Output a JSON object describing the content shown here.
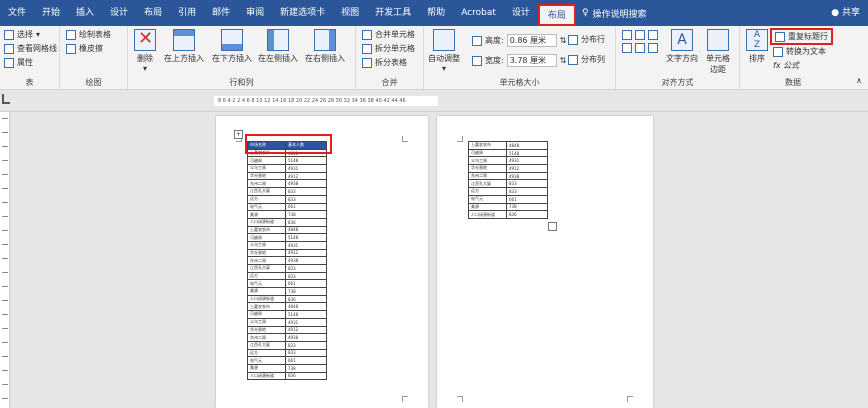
{
  "menubar": {
    "tabs": [
      "文件",
      "开始",
      "插入",
      "设计",
      "布局",
      "引用",
      "邮件",
      "审阅",
      "新建选项卡",
      "视图",
      "开发工具",
      "帮助",
      "Acrobat",
      "设计",
      "布局"
    ],
    "active_tab": "布局",
    "tell_me": "操作说明搜索",
    "share": "共享"
  },
  "ribbon": {
    "table": {
      "select": "选择",
      "gridlines": "查看网格线",
      "properties": "属性",
      "label": "表"
    },
    "draw": {
      "draw_table": "绘制表格",
      "eraser": "橡皮擦",
      "label": "绘图"
    },
    "rows_cols": {
      "delete": "删除",
      "insert_above": "在上方插入",
      "insert_below": "在下方插入",
      "insert_left": "在左侧插入",
      "insert_right": "在右侧插入",
      "label": "行和列"
    },
    "merge": {
      "merge_cells": "合并单元格",
      "split_cells": "拆分单元格",
      "split_table": "拆分表格",
      "label": "合并"
    },
    "cell_size": {
      "autofit": "自动调整",
      "height_label": "高度:",
      "height_value": "0.86 厘米",
      "width_label": "宽度:",
      "width_value": "3.78 厘米",
      "distribute_rows": "分布行",
      "distribute_cols": "分布列",
      "label": "单元格大小"
    },
    "alignment": {
      "text_direction": "文字方向",
      "cell_margins": "单元格\n边距",
      "label": "对齐方式"
    },
    "data": {
      "sort": "排序",
      "repeat_header": "重复标题行",
      "convert_text": "转换为文本",
      "formula": "fx 公式",
      "label": "数据"
    }
  },
  "ruler": {
    "text": "8  6  4  2      2  4  6  8  10  12  14  16  18  20  22  24  26  28  30  32  34  36  38  40  42  44  46"
  },
  "document": {
    "page1_table": {
      "header": [
        "市场名称",
        "基本人数"
      ],
      "rows": [
        [
          "上嘉农农市",
          "4848"
        ],
        [
          "可越周",
          "5148"
        ],
        [
          "义乌工周",
          "4931"
        ],
        [
          "华光香地",
          "4912"
        ],
        [
          "东州二周",
          "4938"
        ],
        [
          "江西孔大厦",
          "833"
        ],
        [
          "远方",
          "833"
        ],
        [
          "电气元",
          "661"
        ],
        [
          "美源",
          "738"
        ],
        [
          "人口闭源街道",
          "836"
        ],
        [
          "上嘉农农市",
          "4848"
        ],
        [
          "可越周",
          "5148"
        ],
        [
          "义乌工周",
          "4931"
        ],
        [
          "华光香地",
          "4912"
        ],
        [
          "东州二周",
          "4938"
        ],
        [
          "江西孔大厦",
          "833"
        ],
        [
          "远方",
          "833"
        ],
        [
          "电气元",
          "661"
        ],
        [
          "美源",
          "738"
        ],
        [
          "人口闭源街道",
          "836"
        ],
        [
          "上嘉农农市",
          "4848"
        ],
        [
          "可越周",
          "5148"
        ],
        [
          "义乌工周",
          "4931"
        ],
        [
          "华光香地",
          "4912"
        ],
        [
          "东州二周",
          "4938"
        ],
        [
          "江西孔大厦",
          "833"
        ],
        [
          "远方",
          "833"
        ],
        [
          "电气元",
          "661"
        ],
        [
          "美源",
          "738"
        ],
        [
          "人口闭源街道",
          "836"
        ]
      ]
    },
    "page2_table": {
      "rows": [
        [
          "上嘉农农市",
          "4848"
        ],
        [
          "可越周",
          "5148"
        ],
        [
          "义乌工周",
          "4931"
        ],
        [
          "华光香地",
          "4912"
        ],
        [
          "东州二周",
          "4938"
        ],
        [
          "江西孔大厦",
          "833"
        ],
        [
          "远方",
          "833"
        ],
        [
          "电气元",
          "661"
        ],
        [
          "美源",
          "738"
        ],
        [
          "人口闭源街道",
          "836"
        ]
      ]
    }
  },
  "colors": {
    "brand": "#2b579a",
    "highlight": "#e02020"
  }
}
